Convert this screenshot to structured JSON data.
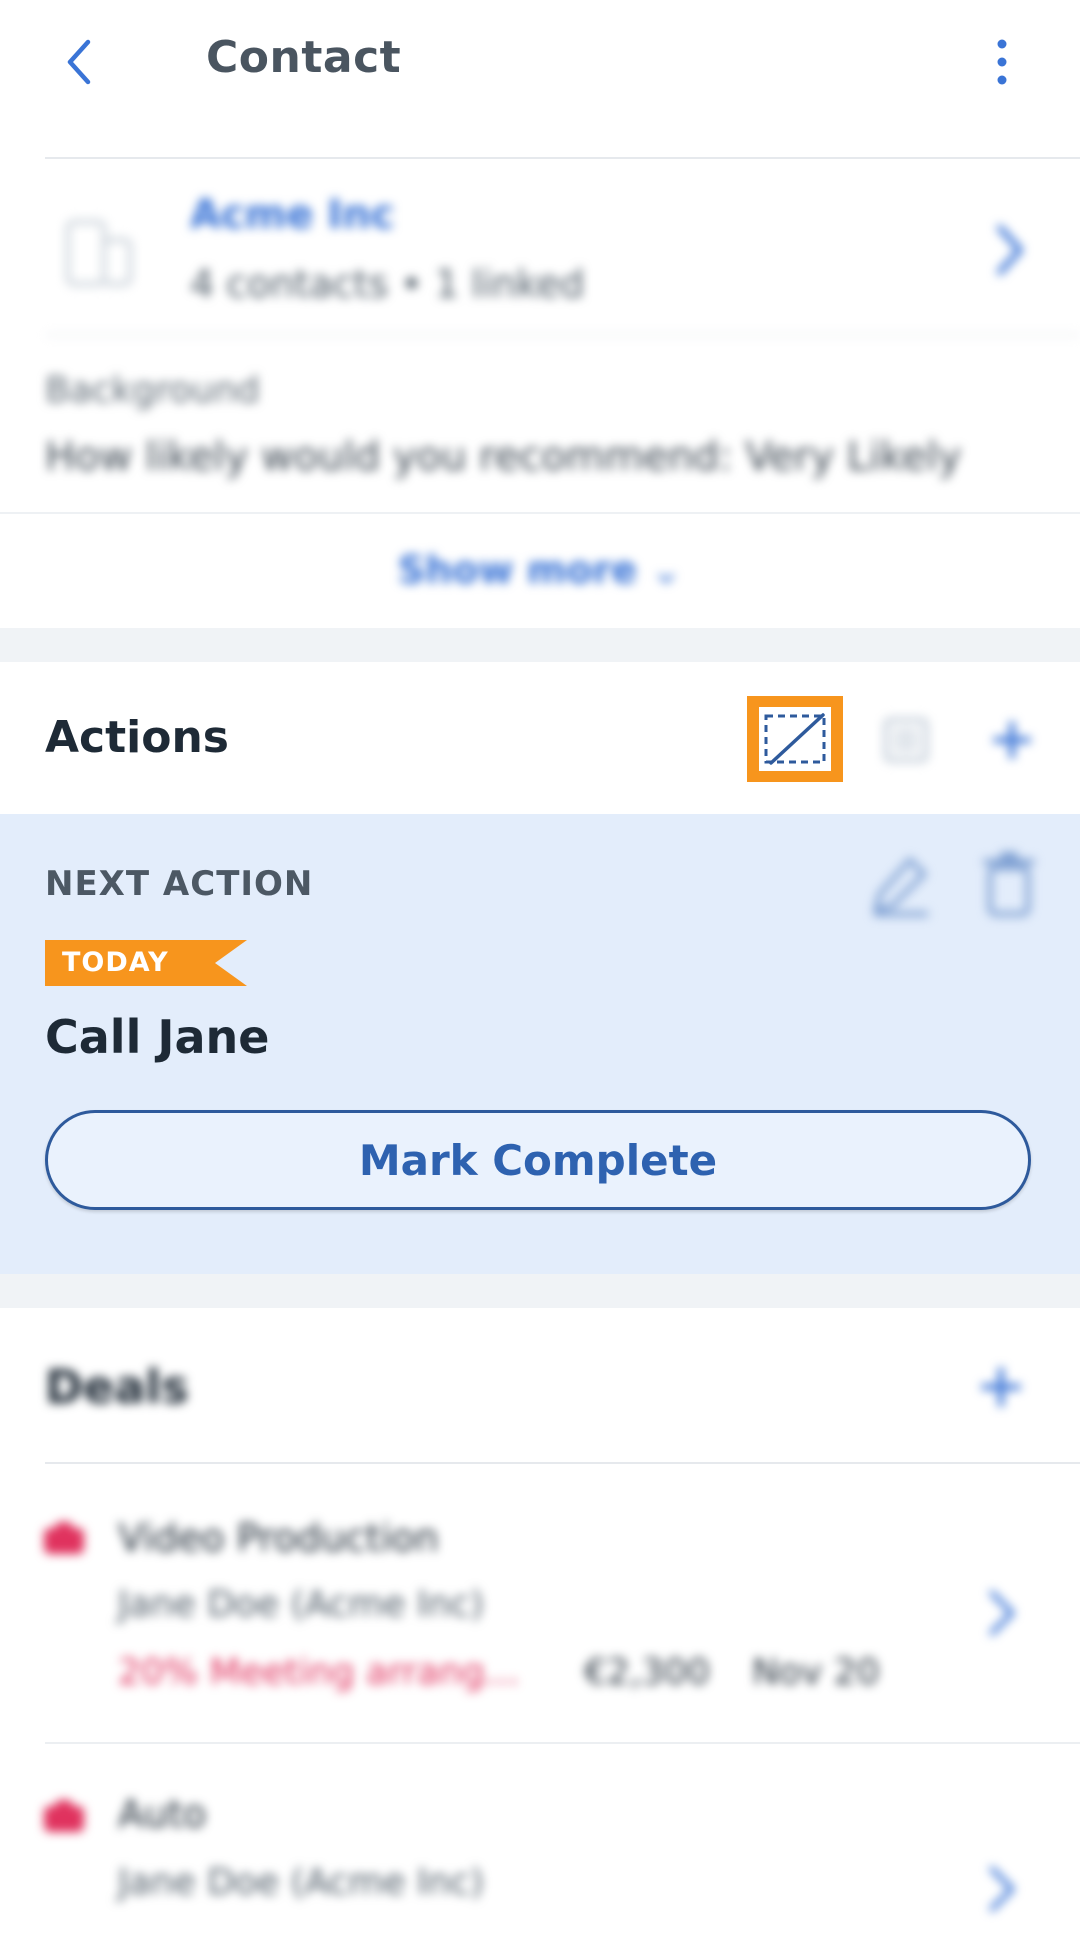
{
  "header": {
    "title": "Contact",
    "back_icon": "chevron-left-icon",
    "menu_icon": "more-vertical-icon"
  },
  "company": {
    "name": "Acme Inc",
    "subtitle": "4 contacts • 1 linked",
    "icon": "company-icon"
  },
  "background": {
    "label": "Background",
    "text": "How likely would you recommend: Very Likely"
  },
  "show_more": {
    "label": "Show more",
    "icon": "chevron-down-icon"
  },
  "actions": {
    "title": "Actions",
    "toolbar_icons": [
      "focus-mode-icon",
      "list-icon",
      "plus-icon"
    ],
    "next_action": {
      "label": "NEXT ACTION",
      "badge": "TODAY",
      "title": "Call Jane",
      "button": "Mark Complete",
      "icons": [
        "edit-icon",
        "trash-icon"
      ]
    }
  },
  "deals": {
    "title": "Deals",
    "items": [
      {
        "title": "Video Production",
        "contact": "Jane Doe (Acme Inc)",
        "status": "20% Meeting arrang...",
        "amount": "€2,300",
        "date": "Nov 20"
      },
      {
        "title": "Auto",
        "contact": "Jane Doe (Acme Inc)"
      }
    ]
  },
  "colors": {
    "accent": "#3a74d6",
    "brand_dark": "#2e5a9c",
    "highlight": "#f7951d",
    "next_action_bg": "#e3edfb",
    "deal_status": "#e0325e",
    "section_gap": "#f0f3f6"
  }
}
